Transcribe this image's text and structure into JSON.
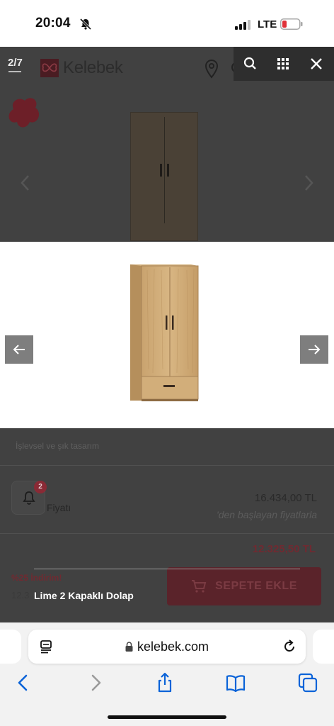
{
  "status_bar": {
    "time": "20:04",
    "network": "LTE",
    "icons": [
      "bell-slash-icon",
      "signal-bars-icon",
      "battery-low-icon"
    ],
    "battery_color": "#e0323a"
  },
  "background_page": {
    "counter": "2/7",
    "logo_text": "Kelebek",
    "brand_color": "#b9182d",
    "header_icons": [
      "location-pin-icon",
      "search-icon",
      "heart-icon",
      "user-icon",
      "cart-icon"
    ],
    "spec_text": "İşlevsel ve şık tasarım",
    "notification_count": "2",
    "price_label": "Fiyatı",
    "old_price": "16.434,00 TL",
    "from_note": "'den başlayan fiyatlarla",
    "sale_price": "12.325,50 TL",
    "discount_label": "%25 İndirim!",
    "truncated_price": "12.3",
    "cart_button": "SEPETE EKLE"
  },
  "lightbox": {
    "toolbar_icons": [
      "zoom-icon",
      "grid-icon",
      "close-icon"
    ],
    "prev_icon": "arrow-left-icon",
    "next_icon": "arrow-right-icon",
    "caption": "Lime 2 Kapaklı Dolap"
  },
  "browser": {
    "url": "kelebek.com",
    "toolbar": [
      "back-icon",
      "forward-icon",
      "share-icon",
      "bookmarks-icon",
      "tabs-icon"
    ],
    "accent": "#0a63d8"
  }
}
